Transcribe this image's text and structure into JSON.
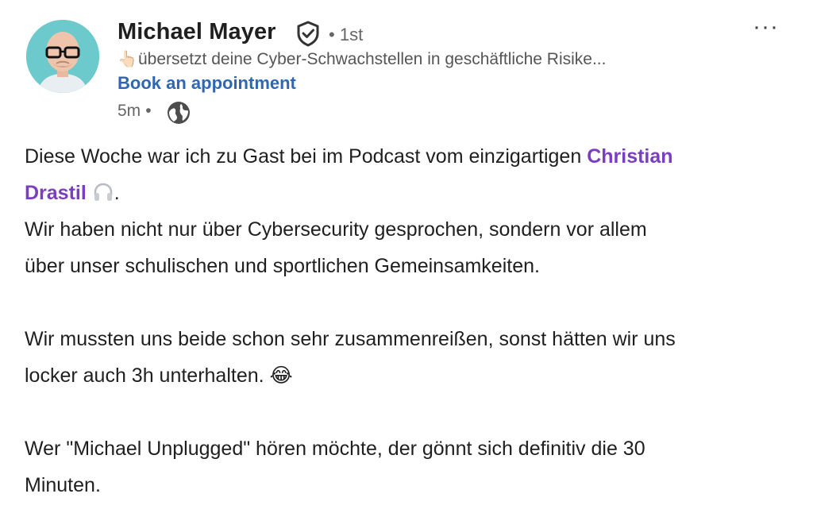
{
  "author": {
    "name": "Michael Mayer",
    "degree": "1st",
    "headline_emoji": "👆🏻",
    "headline": "übersetzt deine Cyber-Schwachstellen in geschäftliche Risike...",
    "cta_label": "Book an appointment"
  },
  "meta": {
    "time": "5m"
  },
  "menu": {
    "more_label": "···"
  },
  "post": {
    "line1_text": "Diese Woche war ich zu Gast bei im Podcast vom einzigartigen ",
    "mention_first": "Christian",
    "mention_last": "Drastil",
    "after_mention": ".",
    "line3": "Wir haben nicht nur über Cybersecurity gesprochen, sondern vor allem",
    "line4": "über unser schulischen und sportlichen Gemeinsamkeiten.",
    "line6": "Wir mussten uns beide schon sehr zusammenreißen, sonst hätten wir uns",
    "line7": "locker auch 3h unterhalten.",
    "line7_emoji": "😂",
    "line9": "Wer \"Michael Unplugged\" hören möchte, der gönnt sich definitiv die 30",
    "line10": "Minuten."
  },
  "colors": {
    "link_blue": "#2f67b2",
    "mention_purple": "#7a3fbf",
    "text": "#1f1f1f",
    "muted": "#666666"
  }
}
